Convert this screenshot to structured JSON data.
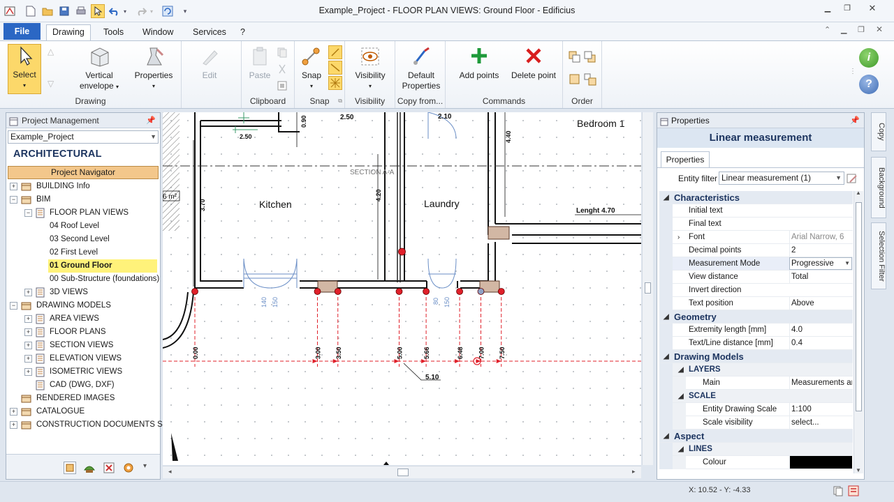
{
  "window": {
    "title": "Example_Project -  FLOOR PLAN VIEWS: Ground Floor - Edificius"
  },
  "menu": {
    "file": "File",
    "tabs": [
      "Drawing",
      "Tools",
      "Window",
      "Services",
      "?"
    ]
  },
  "ribbon": {
    "select": "Select",
    "vertical_envelope": "Vertical envelope",
    "properties": "Properties",
    "edit": "Edit",
    "paste": "Paste",
    "snap": "Snap",
    "visibility": "Visibility",
    "default_properties": "Default Properties",
    "add_points": "Add points",
    "delete_point": "Delete point",
    "groups": {
      "drawing": "Drawing",
      "clipboard": "Clipboard",
      "snap": "Snap",
      "visibility": "Visibility",
      "copy_from": "Copy from...",
      "commands": "Commands",
      "order": "Order"
    }
  },
  "project_panel": {
    "title": "Project Management",
    "project": "Example_Project",
    "section": "ARCHITECTURAL",
    "navigator": "Project Navigator",
    "tree": [
      {
        "label": "BUILDING Info",
        "level": 0,
        "expander": "+"
      },
      {
        "label": "BIM",
        "level": 0,
        "expander": "−"
      },
      {
        "label": "FLOOR PLAN VIEWS",
        "level": 1,
        "expander": "−"
      },
      {
        "label": "04 Roof Level",
        "level": 2,
        "expander": ""
      },
      {
        "label": "03 Second Level",
        "level": 2,
        "expander": ""
      },
      {
        "label": "02 First Level",
        "level": 2,
        "expander": ""
      },
      {
        "label": "01 Ground Floor",
        "level": 2,
        "expander": "",
        "selected": true
      },
      {
        "label": "00 Sub-Structure (foundations)",
        "level": 2,
        "expander": ""
      },
      {
        "label": "3D VIEWS",
        "level": 1,
        "expander": "+"
      },
      {
        "label": "DRAWING MODELS",
        "level": 0,
        "expander": "−"
      },
      {
        "label": "AREA VIEWS",
        "level": 1,
        "expander": "+"
      },
      {
        "label": "FLOOR PLANS",
        "level": 1,
        "expander": "+"
      },
      {
        "label": "SECTION VIEWS",
        "level": 1,
        "expander": "+"
      },
      {
        "label": "ELEVATION VIEWS",
        "level": 1,
        "expander": "+"
      },
      {
        "label": "ISOMETRIC VIEWS",
        "level": 1,
        "expander": "+"
      },
      {
        "label": "CAD (DWG, DXF)",
        "level": 1,
        "expander": ""
      },
      {
        "label": "RENDERED IMAGES",
        "level": 0,
        "expander": ""
      },
      {
        "label": "CATALOGUE",
        "level": 0,
        "expander": "+"
      },
      {
        "label": "CONSTRUCTION DOCUMENTS SET",
        "level": 0,
        "expander": "+"
      }
    ]
  },
  "drawing": {
    "rooms": [
      "Kitchen",
      "Laundry",
      "Bedroom 1"
    ],
    "area_partial": "6 m²",
    "section": "SECTION A-A",
    "length_label": "Lenght 4.70",
    "dims_top": [
      "2.50",
      "2.10",
      "0.90",
      "2.50",
      "4.40"
    ],
    "dims_side": [
      "3.70",
      "4.20"
    ],
    "openings": [
      "140",
      "150",
      "80",
      "150"
    ],
    "measure_values": [
      "0.00",
      "3.00",
      "3.50",
      "5.00",
      "5.66",
      "6.48",
      "7.00",
      "7.50"
    ],
    "measure_callout": "5.10"
  },
  "properties_panel": {
    "title": "Properties",
    "heading": "Linear measurement",
    "tab": "Properties",
    "entity_filter_label": "Entity filter",
    "entity_filter_value": "Linear measurement (1)",
    "rows": [
      {
        "type": "cat",
        "name": "Characteristics"
      },
      {
        "type": "prop",
        "name": "Initial text",
        "value": ""
      },
      {
        "type": "prop",
        "name": "Final text",
        "value": ""
      },
      {
        "type": "prop",
        "name": "Font",
        "value": "Arial Narrow, 6",
        "expander": ">",
        "muted": true
      },
      {
        "type": "prop",
        "name": "Decimal points",
        "value": "2"
      },
      {
        "type": "prop",
        "name": "Measurement Mode",
        "value": "Progressive",
        "dropdown": true,
        "highlight": true
      },
      {
        "type": "prop",
        "name": "View distance",
        "value": "Total"
      },
      {
        "type": "prop",
        "name": "Invert direction",
        "value": "",
        "checkbox": true
      },
      {
        "type": "prop",
        "name": "Text position",
        "value": "Above"
      },
      {
        "type": "cat",
        "name": "Geometry"
      },
      {
        "type": "prop",
        "name": "Extremity length  [mm]",
        "value": "4.0"
      },
      {
        "type": "prop",
        "name": "Text/Line distance  [mm]",
        "value": "0.4"
      },
      {
        "type": "cat",
        "name": "Drawing Models"
      },
      {
        "type": "sub",
        "name": "LAYERS"
      },
      {
        "type": "prop2",
        "name": "Main",
        "value": "Measurements ar"
      },
      {
        "type": "sub",
        "name": "SCALE"
      },
      {
        "type": "prop2",
        "name": "Entity Drawing Scale",
        "value": "1:100"
      },
      {
        "type": "prop2",
        "name": "Scale visibility",
        "value": "select..."
      },
      {
        "type": "cat",
        "name": "Aspect"
      },
      {
        "type": "sub",
        "name": "LINES"
      },
      {
        "type": "prop2",
        "name": "Colour",
        "value": "",
        "swatch": "#000000"
      }
    ]
  },
  "side_tabs": [
    "Copy",
    "Background",
    "Selection Filter"
  ],
  "status": {
    "coords": "X: 10.52 - Y: -4.33"
  },
  "colors": {
    "accent": "#2b67c4",
    "selection": "#fcd86a",
    "dimension_red": "#e0202a",
    "navigator": "#f3c78b"
  }
}
